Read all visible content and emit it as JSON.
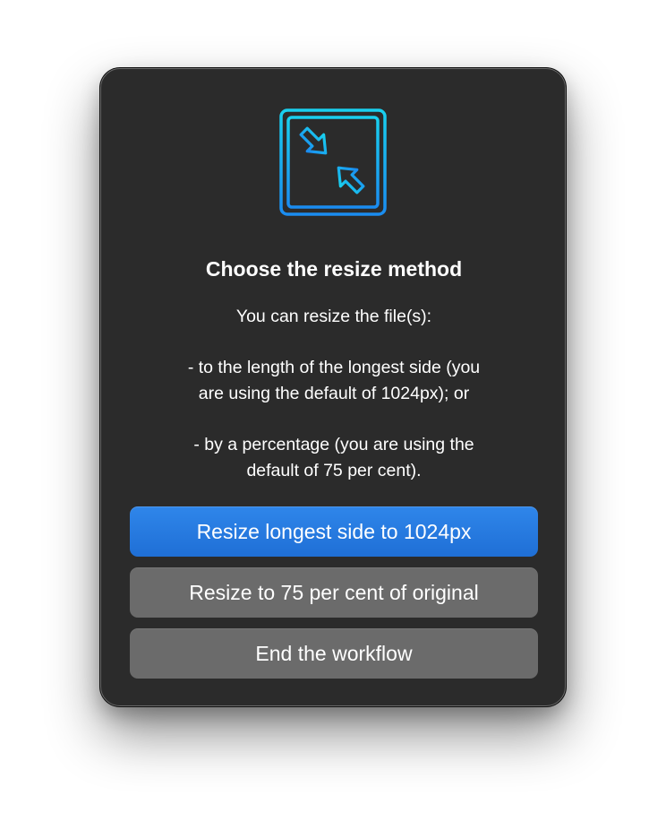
{
  "dialog": {
    "icon": "resize-arrows-icon",
    "title": "Choose the resize method",
    "message": {
      "intro": "You can resize the file(s):",
      "option_a_line1": "- to the length of the longest side (you",
      "option_a_line2": "are using the default of 1024px); or",
      "option_b_line1": "- by a percentage (you are using the",
      "option_b_line2": "default of 75 per cent)."
    },
    "buttons": {
      "primary_label": "Resize longest side to 1024px",
      "percent_label": "Resize to 75 per cent of original",
      "end_label": "End the workflow"
    }
  },
  "colors": {
    "dialog_background": "#2b2b2b",
    "primary_button": "#2f86ea",
    "secondary_button": "#6b6b6b",
    "icon_gradient_top": "#19d0ef",
    "icon_gradient_bottom": "#1a8cf0"
  }
}
